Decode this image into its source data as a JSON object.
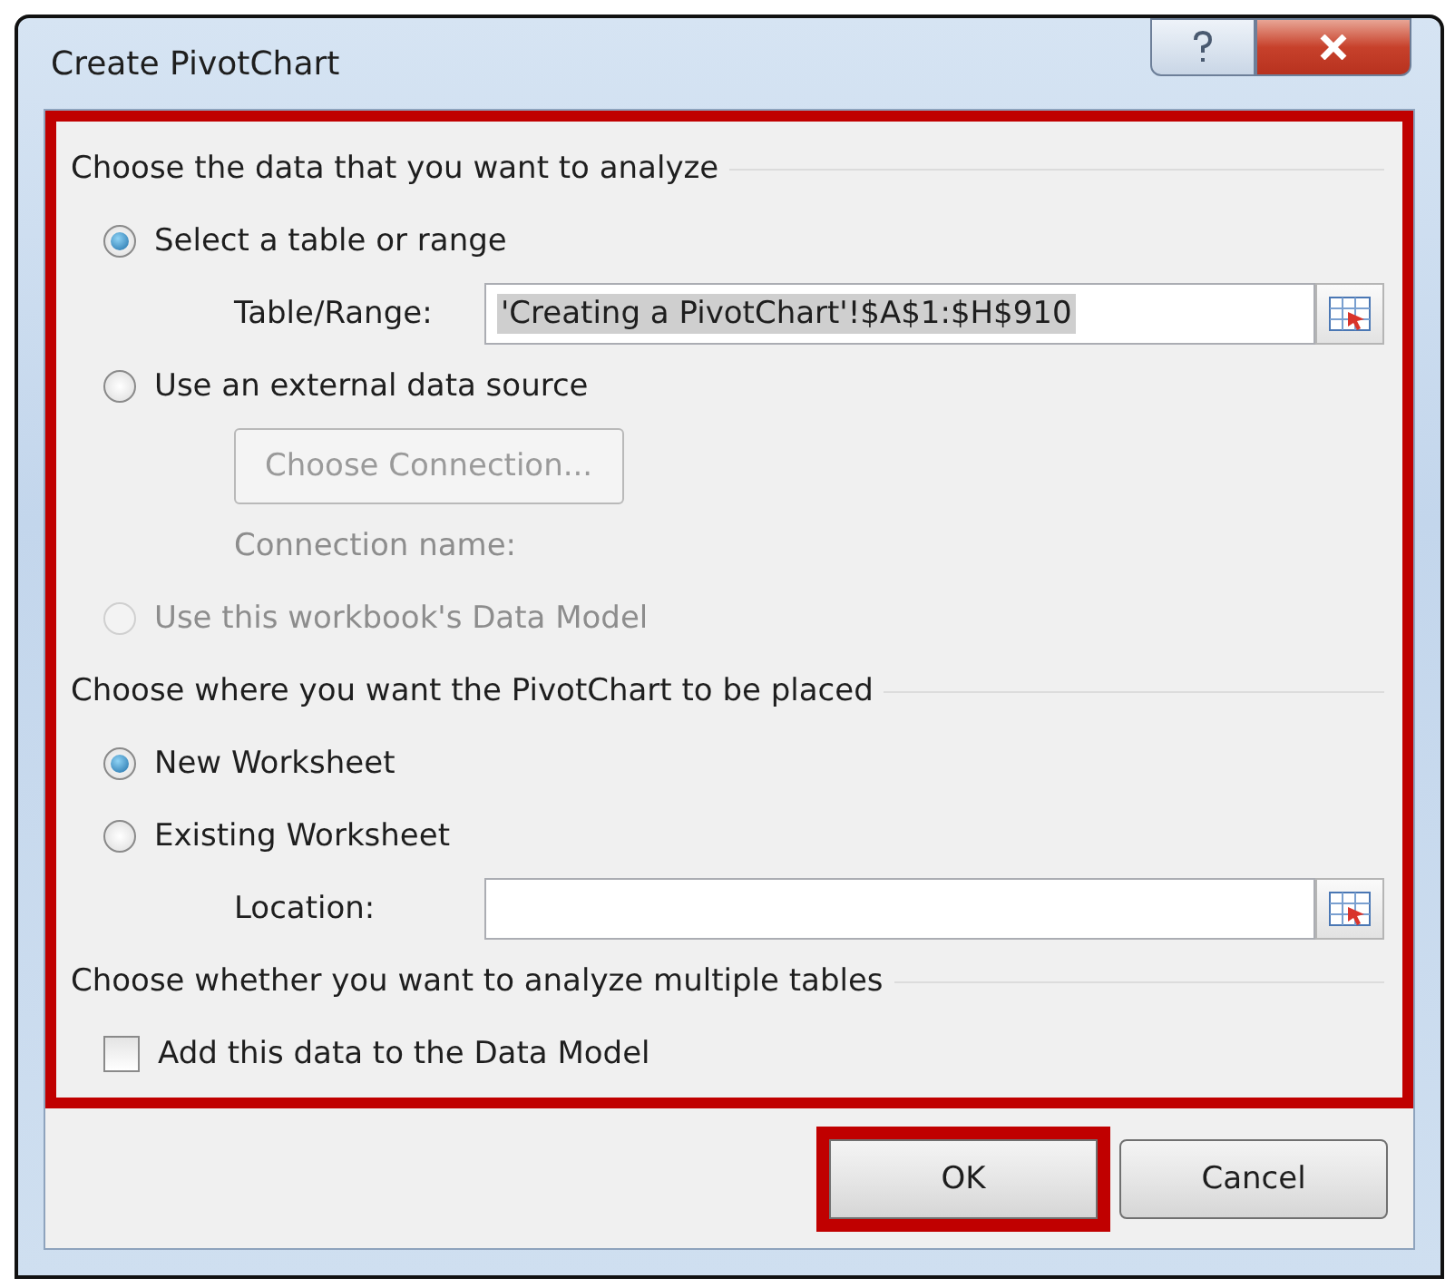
{
  "window": {
    "title": "Create PivotChart"
  },
  "frame_highlighted": true,
  "sections": [
    {
      "heading": "Choose the data that you want to analyze",
      "items": [
        {
          "kind": "radio",
          "label": "Select a table or range",
          "selected": true,
          "disabled": false
        },
        {
          "kind": "field",
          "label": "Table/Range:",
          "value": "'Creating a PivotChart'!$A$1:$H$910",
          "value_selected": true
        },
        {
          "kind": "radio",
          "label": "Use an external data source",
          "selected": false,
          "disabled": false
        },
        {
          "kind": "button",
          "label": "Choose Connection...",
          "disabled": true
        },
        {
          "kind": "label",
          "label": "Connection name:",
          "disabled": true
        },
        {
          "kind": "radio",
          "label": "Use this workbook's Data Model",
          "selected": false,
          "disabled": true
        }
      ]
    },
    {
      "heading": "Choose where you want the PivotChart to be placed",
      "items": [
        {
          "kind": "radio",
          "label": "New Worksheet",
          "selected": true,
          "disabled": false
        },
        {
          "kind": "radio",
          "label": "Existing Worksheet",
          "selected": false,
          "disabled": false
        },
        {
          "kind": "field",
          "label": "Location:",
          "value": ""
        }
      ]
    },
    {
      "heading": "Choose whether you want to analyze multiple tables",
      "items": [
        {
          "kind": "checkbox",
          "label": "Add this data to the Data Model",
          "checked": false
        }
      ]
    }
  ],
  "buttons": [
    {
      "label": "OK",
      "highlighted": true
    },
    {
      "label": "Cancel",
      "highlighted": false
    }
  ]
}
